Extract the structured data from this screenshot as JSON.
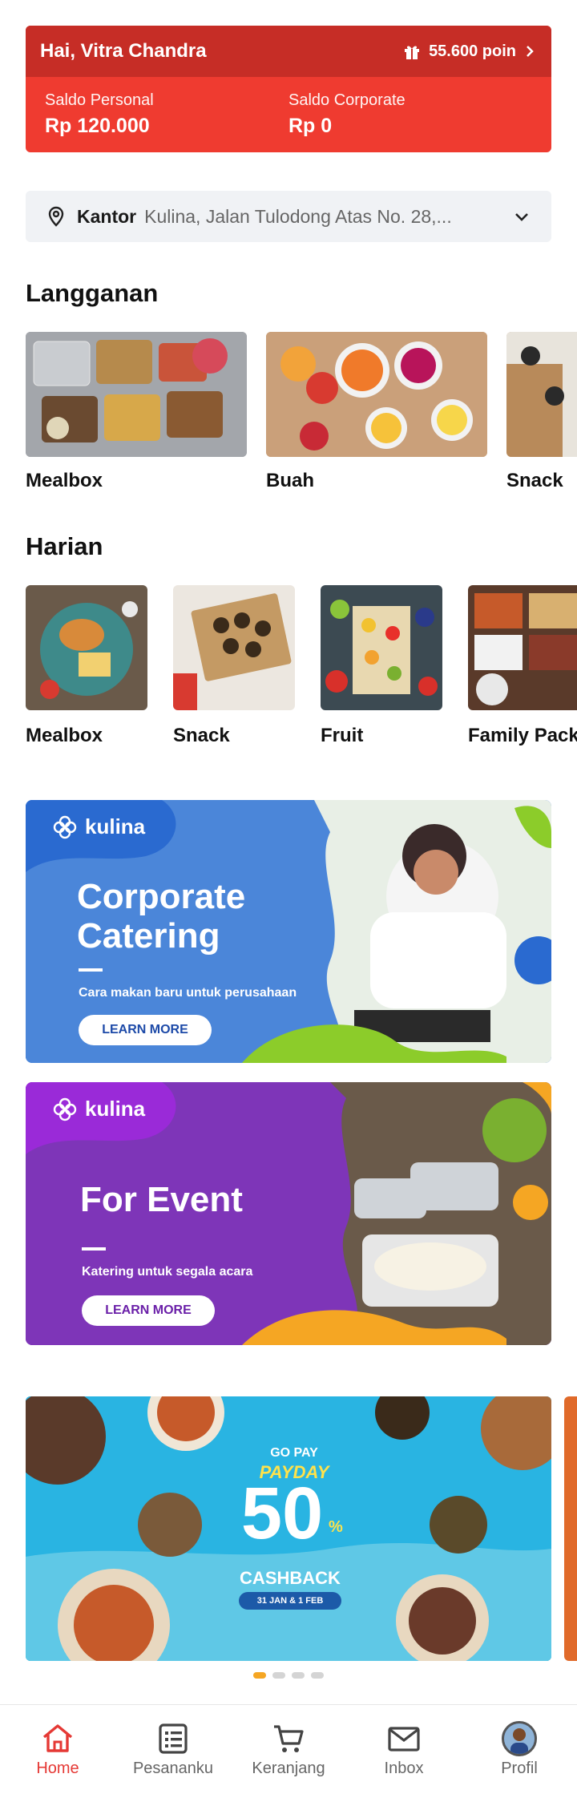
{
  "header": {
    "greeting": "Hai, Vitra Chandra",
    "points": "55.600 poin",
    "personal_label": "Saldo Personal",
    "personal_value": "Rp 120.000",
    "corporate_label": "Saldo Corporate",
    "corporate_value": "Rp 0"
  },
  "address": {
    "type": "Kantor",
    "text": "Kulina, Jalan Tulodong Atas No. 28,..."
  },
  "langganan": {
    "title": "Langganan",
    "items": [
      "Mealbox",
      "Buah",
      "Snack"
    ]
  },
  "harian": {
    "title": "Harian",
    "items": [
      "Mealbox",
      "Snack",
      "Fruit",
      "Family Pack"
    ]
  },
  "banners": [
    {
      "brand": "kulina",
      "headline_1": "Corporate",
      "headline_2": "Catering",
      "sub": "Cara makan baru untuk perusahaan",
      "cta": "LEARN MORE",
      "color": "#3d7bd6"
    },
    {
      "brand": "kulina",
      "headline_1": "For Event",
      "sub": "Katering untuk segala acara",
      "cta": "LEARN MORE",
      "color": "#7b2fb8"
    }
  ],
  "promo": {
    "brand": "GO PAY",
    "title": "PAYDAY",
    "big": "50",
    "percent": "%",
    "label": "CASHBACK",
    "date": "31 JAN & 1 FEB"
  },
  "nav": [
    {
      "label": "Home",
      "icon": "home-icon"
    },
    {
      "label": "Pesananku",
      "icon": "list-icon"
    },
    {
      "label": "Keranjang",
      "icon": "cart-icon"
    },
    {
      "label": "Inbox",
      "icon": "mail-icon"
    },
    {
      "label": "Profil",
      "icon": "avatar"
    }
  ],
  "colors": {
    "accent": "#ef3b30",
    "accent_dark": "#c62d26"
  }
}
